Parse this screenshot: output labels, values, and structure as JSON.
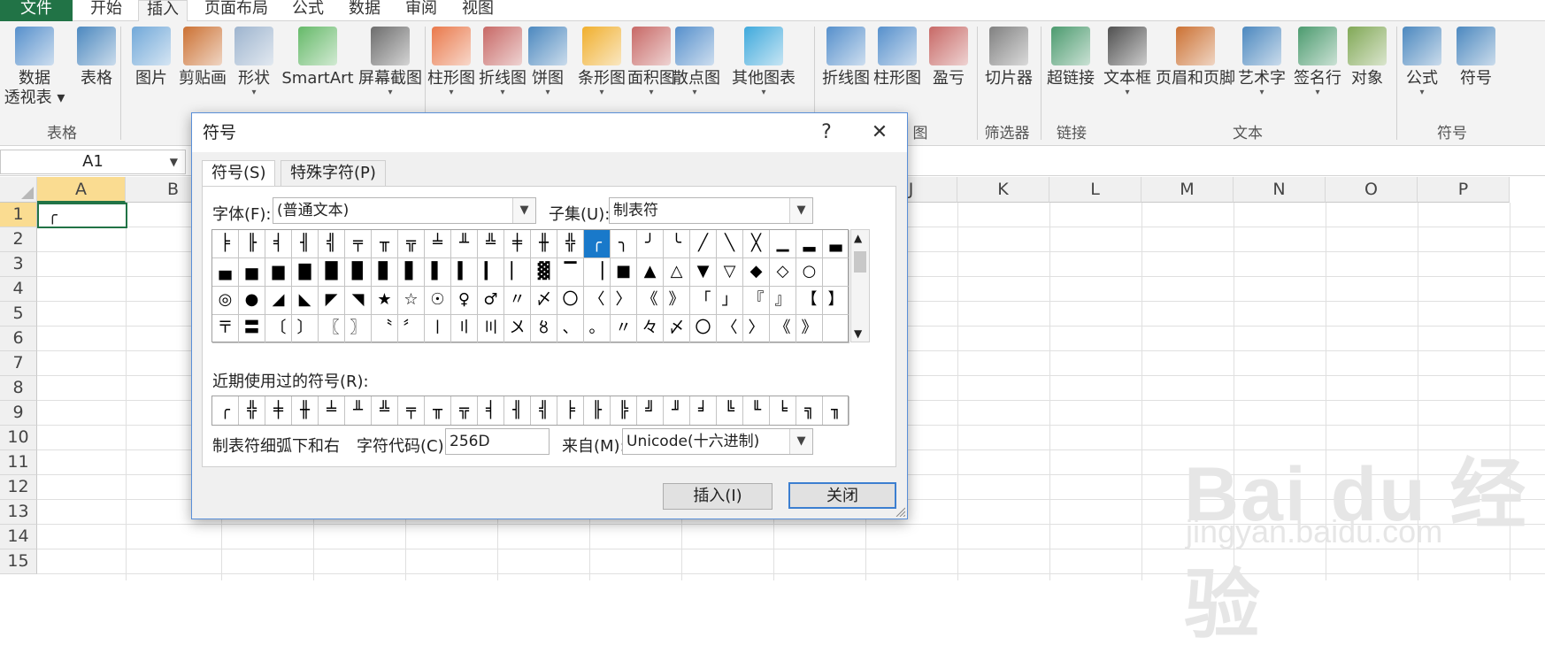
{
  "tabs": [
    "文件",
    "开始",
    "插入",
    "页面布局",
    "公式",
    "数据",
    "审阅",
    "视图"
  ],
  "ribbon": {
    "items": [
      {
        "label": "数据",
        "label2": "透视表 ▾",
        "icon": "pivot-table-icon"
      },
      {
        "label": "表格",
        "icon": "table-icon"
      },
      {
        "label": "图片",
        "icon": "picture-icon"
      },
      {
        "label": "剪贴画",
        "icon": "clipart-icon"
      },
      {
        "label": "形状",
        "icon": "shapes-icon",
        "drop": true
      },
      {
        "label": "SmartArt",
        "icon": "smartart-icon"
      },
      {
        "label": "屏幕截图",
        "icon": "screenshot-icon",
        "drop": true
      },
      {
        "label": "柱形图",
        "icon": "column-chart-icon",
        "drop": true
      },
      {
        "label": "折线图",
        "icon": "line-chart-icon",
        "drop": true
      },
      {
        "label": "饼图",
        "icon": "pie-chart-icon",
        "drop": true
      },
      {
        "label": "条形图",
        "icon": "bar-chart-icon",
        "drop": true
      },
      {
        "label": "面积图",
        "icon": "area-chart-icon",
        "drop": true
      },
      {
        "label": "散点图",
        "icon": "scatter-chart-icon",
        "drop": true
      },
      {
        "label": "其他图表",
        "icon": "other-charts-icon",
        "drop": true
      },
      {
        "label": "折线图",
        "icon": "sparkline-line-icon"
      },
      {
        "label": "柱形图",
        "icon": "sparkline-column-icon"
      },
      {
        "label": "盈亏",
        "icon": "sparkline-winloss-icon"
      },
      {
        "label": "切片器",
        "icon": "slicer-icon"
      },
      {
        "label": "超链接",
        "icon": "hyperlink-icon"
      },
      {
        "label": "文本框",
        "icon": "textbox-icon",
        "drop": true
      },
      {
        "label": "页眉和页脚",
        "icon": "header-footer-icon"
      },
      {
        "label": "艺术字",
        "icon": "wordart-icon",
        "drop": true
      },
      {
        "label": "签名行",
        "icon": "signature-line-icon",
        "drop": true
      },
      {
        "label": "对象",
        "icon": "object-icon"
      },
      {
        "label": "公式",
        "icon": "equation-icon",
        "drop": true
      },
      {
        "label": "符号",
        "icon": "symbol-icon"
      }
    ],
    "groups": [
      "表格",
      "图",
      "筛选器",
      "链接",
      "文本",
      "符号"
    ]
  },
  "namebox": "A1",
  "columns": [
    "A",
    "B",
    "C",
    "D",
    "E",
    "F",
    "G",
    "H",
    "I",
    "J",
    "K",
    "L",
    "M",
    "N",
    "O",
    "P"
  ],
  "rows": [
    "1",
    "2",
    "3",
    "4",
    "5",
    "6",
    "7",
    "8",
    "9",
    "10",
    "11",
    "12",
    "13",
    "14",
    "15"
  ],
  "cell_a1": "╭",
  "dialog": {
    "title": "符号",
    "help": "?",
    "close": "✕",
    "tab_symbols": "符号(S)",
    "tab_special": "特殊字符(P)",
    "font_label": "字体(F):",
    "font_value": "(普通文本)",
    "subset_label": "子集(U):",
    "subset_value": "制表符",
    "symbol_rows": [
      [
        "╞",
        "╟",
        "╡",
        "╢",
        "╣",
        "╤",
        "╥",
        "╦",
        "╧",
        "╨",
        "╩",
        "╪",
        "╫",
        "╬",
        "╭",
        "╮",
        "╯",
        "╰",
        "╱",
        "╲",
        "╳",
        "▁",
        "▂",
        "▃"
      ],
      [
        "▄",
        "▅",
        "▆",
        "▇",
        "█",
        "▉",
        "▊",
        "▋",
        "▌",
        "▍",
        "▎",
        "▏",
        "▓",
        "▔",
        "▕",
        "■",
        "▲",
        "△",
        "▼",
        "▽",
        "◆",
        "◇",
        "○",
        ""
      ],
      [
        "◎",
        "●",
        "◢",
        "◣",
        "◤",
        "◥",
        "★",
        "☆",
        "☉",
        "♀",
        "♂",
        "〃",
        "〆",
        "〇",
        "〈",
        "〉",
        "《",
        "》",
        "「",
        "」",
        "『",
        "』",
        "【",
        "】"
      ],
      [
        "〒",
        "〓",
        "〔",
        "〕",
        "〖",
        "〗",
        "〝",
        "〞",
        "〡",
        "〢",
        "〣",
        "〤",
        "〥",
        "、",
        "。",
        "〃",
        "々",
        "〆",
        "〇",
        "〈",
        "〉",
        "《",
        "》",
        ""
      ]
    ],
    "selected_index": 14,
    "recent_label": "近期使用过的符号(R):",
    "recent": [
      "╭",
      "╬",
      "╪",
      "╫",
      "╧",
      "╨",
      "╩",
      "╤",
      "╥",
      "╦",
      "╡",
      "╢",
      "╣",
      "╞",
      "╟",
      "╠",
      "╝",
      "╜",
      "╛",
      "╚",
      "╙",
      "╘",
      "╗",
      "╖"
    ],
    "char_name": "制表符细弧下和右",
    "code_label": "字符代码(C):",
    "code_value": "256D",
    "from_label": "来自(M):",
    "from_value": "Unicode(十六进制)",
    "insert_btn": "插入(I)",
    "close_btn": "关闭"
  },
  "watermark": {
    "brand": "Bai du 经验",
    "url": "jingyan.baidu.com"
  }
}
